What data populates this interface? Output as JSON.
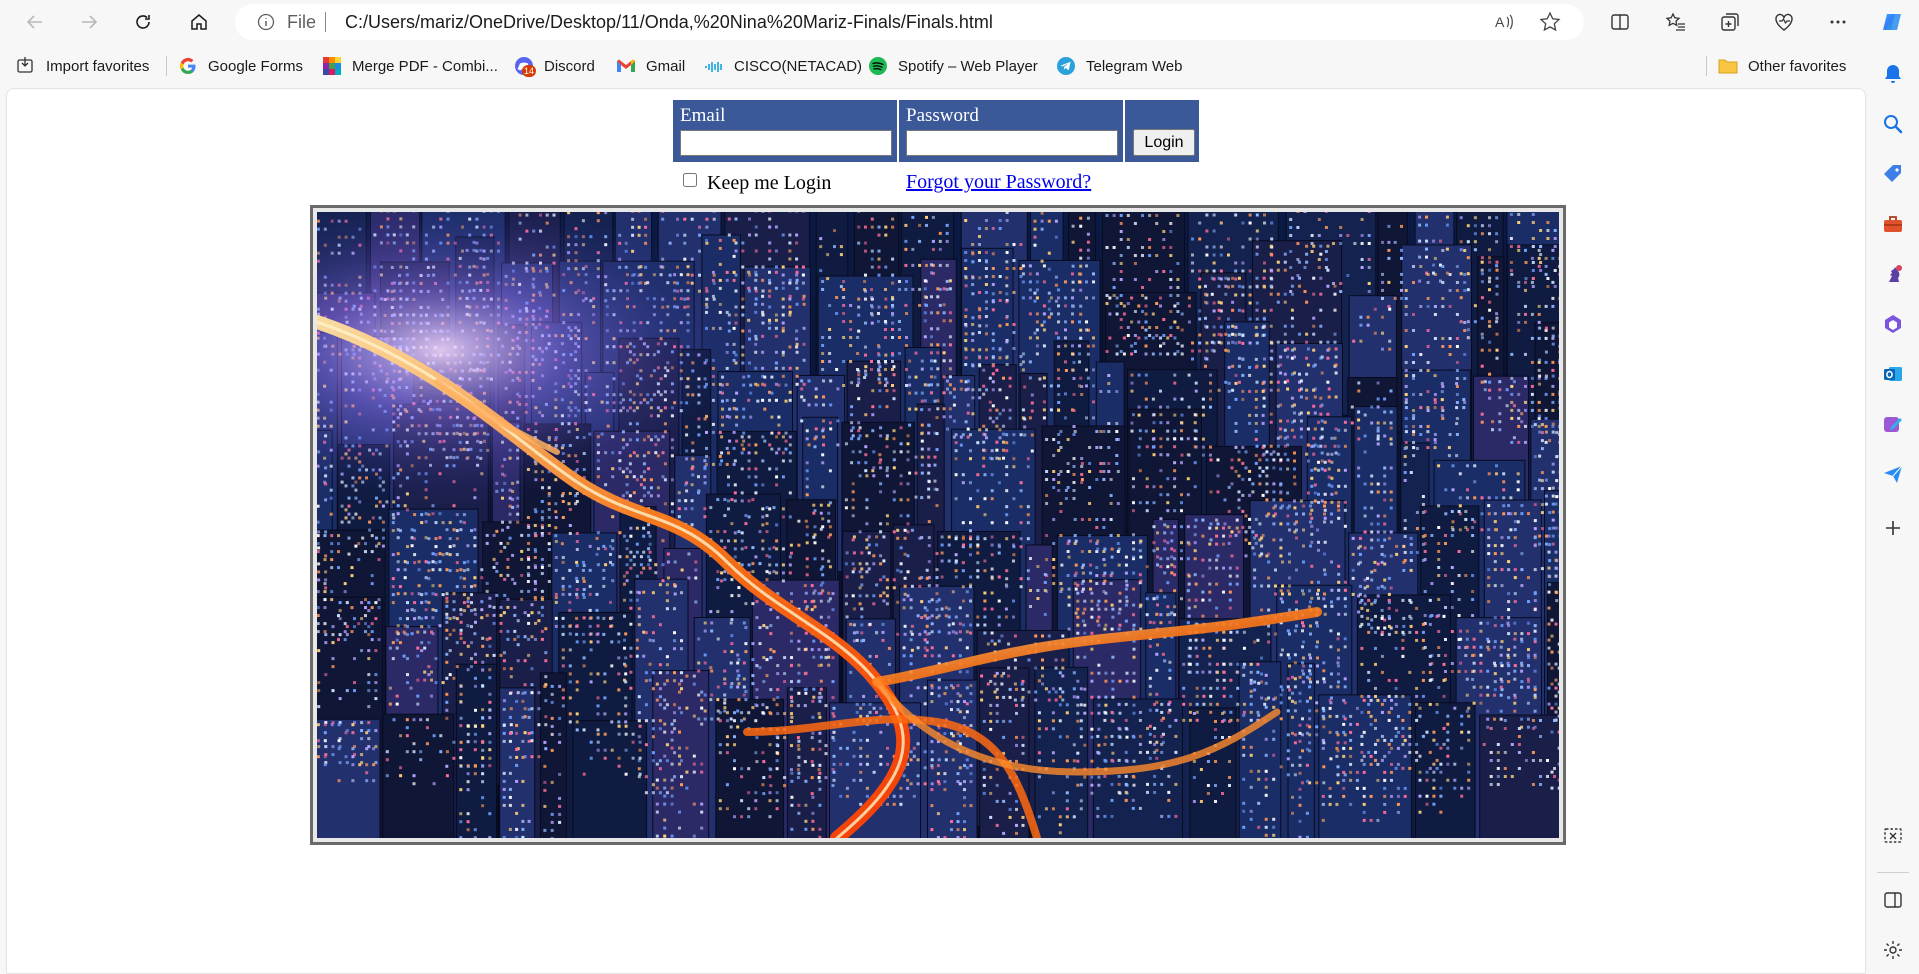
{
  "browser": {
    "address": {
      "scheme": "File",
      "url": "C:/Users/mariz/OneDrive/Desktop/11/Onda,%20Nina%20Mariz-Finals/Finals.html"
    },
    "favorites": [
      {
        "label": "Import favorites",
        "icon": "import-favorites-icon"
      },
      {
        "label": "Google Forms",
        "icon": "google-icon"
      },
      {
        "label": "Merge PDF - Combi...",
        "icon": "merge-pdf-icon"
      },
      {
        "label": "Discord",
        "icon": "discord-icon",
        "badge": "14"
      },
      {
        "label": "Gmail",
        "icon": "gmail-icon"
      },
      {
        "label": "CISCO(NETACAD)",
        "icon": "cisco-icon"
      },
      {
        "label": "Spotify – Web Player",
        "icon": "spotify-icon"
      },
      {
        "label": "Telegram Web",
        "icon": "telegram-icon"
      },
      {
        "label": "Other favorites",
        "icon": "folder-icon"
      }
    ]
  },
  "page": {
    "login": {
      "email_label": "Email",
      "email_value": "",
      "password_label": "Password",
      "password_value": "",
      "login_button": "Login",
      "keep_login_label": "Keep me Login",
      "keep_login_checked": false,
      "forgot_link": "Forgot your Password?",
      "header_color": "#3b5998"
    },
    "hero_image": {
      "subject": "night city skyline with glowing highways"
    }
  }
}
